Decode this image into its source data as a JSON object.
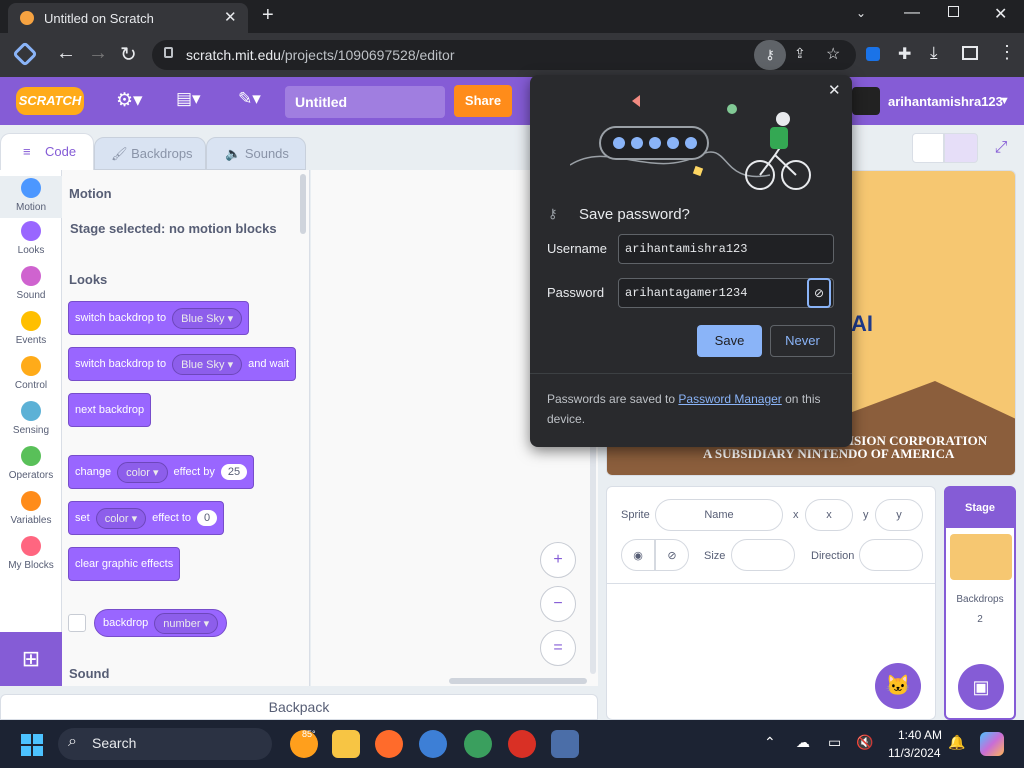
{
  "browser": {
    "tab_title": "Untitled on Scratch",
    "url_host": "scratch.mit.edu",
    "url_path": "/projects/1090697528/editor"
  },
  "menubar": {
    "logo": "SCRATCH",
    "project_title": "Untitled",
    "share_label": "Share",
    "username": "arihantamishra123"
  },
  "tabs": {
    "code": "Code",
    "backdrops": "Backdrops",
    "sounds": "Sounds"
  },
  "categories": [
    {
      "label": "Motion",
      "color": "#4c97ff"
    },
    {
      "label": "Looks",
      "color": "#9966ff"
    },
    {
      "label": "Sound",
      "color": "#cf63cf"
    },
    {
      "label": "Events",
      "color": "#ffbf00"
    },
    {
      "label": "Control",
      "color": "#ffab19"
    },
    {
      "label": "Sensing",
      "color": "#5cb1d6"
    },
    {
      "label": "Operators",
      "color": "#59c059"
    },
    {
      "label": "Variables",
      "color": "#ff8c1a"
    },
    {
      "label": "My Blocks",
      "color": "#ff6680"
    }
  ],
  "palette": {
    "motion_heading": "Motion",
    "motion_note": "Stage selected: no motion blocks",
    "looks_heading": "Looks",
    "sound_heading": "Sound",
    "b1_text": "switch backdrop to",
    "b1_dd": "Blue Sky",
    "b2_text": "switch backdrop to",
    "b2_dd": "Blue Sky",
    "b2_tail": "and wait",
    "b3_text": "next backdrop",
    "b4_text": "change",
    "b4_dd": "color",
    "b4_mid": "effect by",
    "b4_num": "25",
    "b5_text": "set",
    "b5_dd": "color",
    "b5_mid": "effect to",
    "b5_num": "0",
    "b6_text": "clear graphic effects",
    "b7_text": "backdrop",
    "b7_dd": "number"
  },
  "zoom": {
    "in": "+",
    "out": "−",
    "reset": "="
  },
  "backpack": "Backpack",
  "stage_text": {
    "line1": "ISION CORPORATION",
    "line2": "A SUBSIDIARY NINTENDO OF AMERICA",
    "partial": "AI"
  },
  "sprite_info": {
    "sprite_label": "Sprite",
    "name_placeholder": "Name",
    "x_label": "x",
    "x_placeholder": "x",
    "y_label": "y",
    "y_placeholder": "y",
    "size_label": "Size",
    "direction_label": "Direction"
  },
  "stage_panel": {
    "header": "Stage",
    "backdrops_label": "Backdrops",
    "backdrops_count": "2"
  },
  "popup": {
    "title": "Save password?",
    "username_label": "Username",
    "username_value": "arihantamishra123",
    "password_label": "Password",
    "password_value": "arihantagamer1234",
    "save_label": "Save",
    "never_label": "Never",
    "footer_before": "Passwords are saved to ",
    "footer_link": "Password Manager",
    "footer_after": " on this device."
  },
  "taskbar": {
    "search_label": "Search",
    "temperature": "85°",
    "time": "1:40 AM",
    "date": "11/3/2024"
  }
}
